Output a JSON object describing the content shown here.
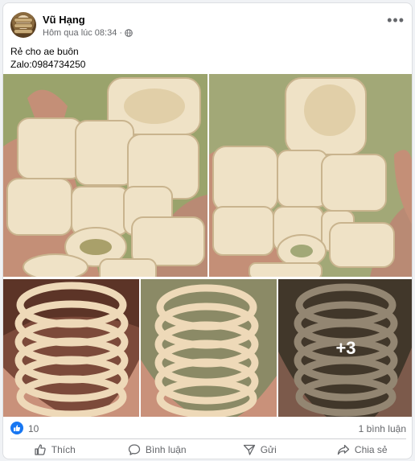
{
  "post": {
    "author": "Vũ Hạng",
    "timestamp": "Hôm qua lúc 08:34",
    "separator": "·",
    "caption_line1": "Rẻ cho ae buôn",
    "caption_line2": "Zalo:0984734250"
  },
  "gallery": {
    "more_count": "+3",
    "photo_count_shown": 5
  },
  "stats": {
    "reactions": "10",
    "comments": "1 bình luận"
  },
  "actions": {
    "like": "Thích",
    "comment": "Bình luận",
    "send": "Gửi",
    "share": "Chia sẻ"
  },
  "colors": {
    "accent": "#1877f2",
    "muted": "#65676b",
    "ivory": "#efe3c9",
    "background": "#f0f2f5"
  },
  "icons": {
    "more": "more-horizontal-icon",
    "privacy": "globe-icon",
    "like_badge": "thumbs-up-icon",
    "like": "thumbs-up-outline-icon",
    "comment": "speech-bubble-icon",
    "send": "send-icon",
    "share": "share-arrow-icon"
  }
}
